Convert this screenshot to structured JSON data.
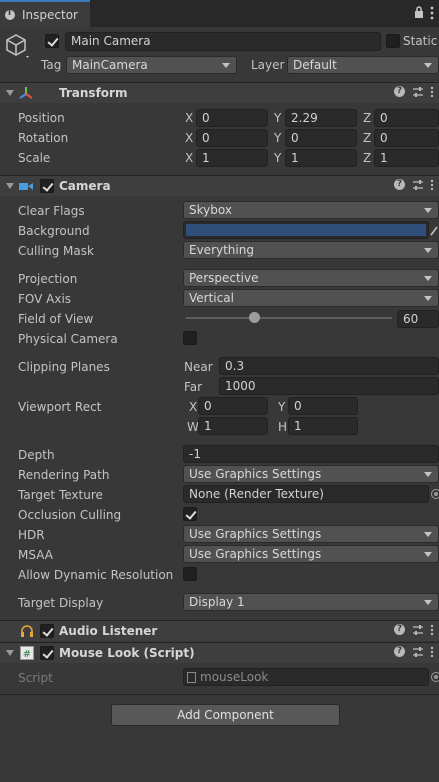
{
  "tab": {
    "label": "Inspector"
  },
  "gameobject": {
    "name": "Main Camera",
    "static_label": "Static",
    "tag_label": "Tag",
    "tag_value": "MainCamera",
    "layer_label": "Layer",
    "layer_value": "Default"
  },
  "transform": {
    "title": "Transform",
    "position_label": "Position",
    "rotation_label": "Rotation",
    "scale_label": "Scale",
    "axis_x": "X",
    "axis_y": "Y",
    "axis_z": "Z",
    "position": {
      "x": "0",
      "y": "2.29",
      "z": "0"
    },
    "rotation": {
      "x": "0",
      "y": "0",
      "z": "0"
    },
    "scale": {
      "x": "1",
      "y": "1",
      "z": "1"
    }
  },
  "camera": {
    "title": "Camera",
    "clear_flags_label": "Clear Flags",
    "clear_flags": "Skybox",
    "background_label": "Background",
    "background_color": "#314d79",
    "culling_mask_label": "Culling Mask",
    "culling_mask": "Everything",
    "projection_label": "Projection",
    "projection": "Perspective",
    "fov_axis_label": "FOV Axis",
    "fov_axis": "Vertical",
    "fov_label": "Field of View",
    "fov": "60",
    "physical_label": "Physical Camera",
    "clipping_label": "Clipping Planes",
    "near_label": "Near",
    "near": "0.3",
    "far_label": "Far",
    "far": "1000",
    "viewport_label": "Viewport Rect",
    "vp_x_label": "X",
    "vp_x": "0",
    "vp_y_label": "Y",
    "vp_y": "0",
    "vp_w_label": "W",
    "vp_w": "1",
    "vp_h_label": "H",
    "vp_h": "1",
    "depth_label": "Depth",
    "depth": "-1",
    "rendering_path_label": "Rendering Path",
    "rendering_path": "Use Graphics Settings",
    "target_texture_label": "Target Texture",
    "target_texture": "None (Render Texture)",
    "occlusion_label": "Occlusion Culling",
    "hdr_label": "HDR",
    "hdr": "Use Graphics Settings",
    "msaa_label": "MSAA",
    "msaa": "Use Graphics Settings",
    "dynres_label": "Allow Dynamic Resolution",
    "target_display_label": "Target Display",
    "target_display": "Display 1"
  },
  "audio_listener": {
    "title": "Audio Listener"
  },
  "mouse_look": {
    "title": "Mouse Look (Script)",
    "script_label": "Script",
    "script_value": "mouseLook"
  },
  "add_component": {
    "label": "Add Component"
  }
}
